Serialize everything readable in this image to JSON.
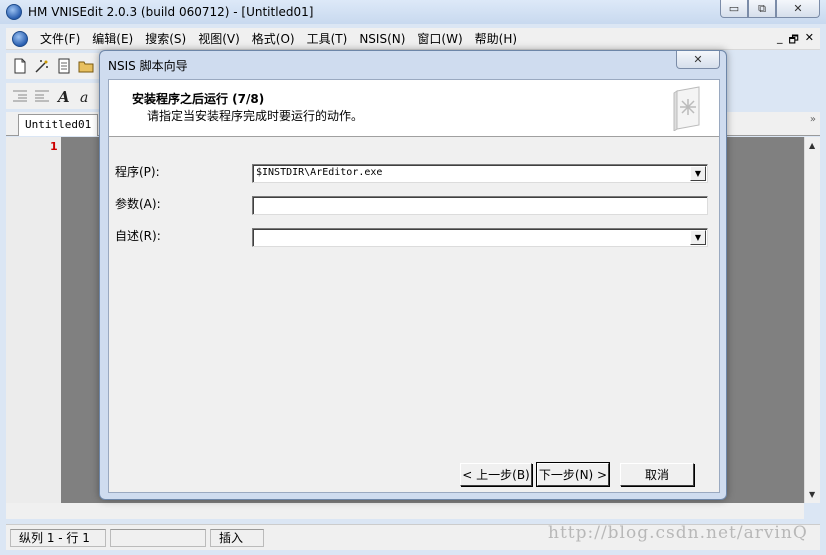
{
  "window": {
    "title": "HM VNISEdit 2.0.3 (build 060712) - [Untitled01]",
    "min_glyph": "▭",
    "restore_glyph": "⧉",
    "close_glyph": "✕"
  },
  "menu": {
    "items": [
      "文件(F)",
      "编辑(E)",
      "搜索(S)",
      "视图(V)",
      "格式(O)",
      "工具(T)",
      "NSIS(N)",
      "窗口(W)",
      "帮助(H)"
    ],
    "mdi_min": "_",
    "mdi_restore": "🗗",
    "mdi_close": "✕"
  },
  "editor": {
    "tab_label": "Untitled01",
    "line_number": "1",
    "tab_scroll": "»"
  },
  "statusbar": {
    "position": "纵列 1 - 行 1",
    "mode": "插入"
  },
  "watermark": "http://blog.csdn.net/arvinQ",
  "dialog": {
    "title": "NSIS 脚本向导",
    "close_glyph": "✕",
    "header_title": "安装程序之后运行 (7/8)",
    "header_subtitle": "请指定当安装程序完成时要运行的动作。",
    "fields": {
      "program_label": "程序(P):",
      "program_value": "$INSTDIR\\ArEditor.exe",
      "params_label": "参数(A):",
      "params_value": "",
      "readme_label": "自述(R):",
      "readme_value": ""
    },
    "buttons": {
      "back": "< 上一步(B)",
      "next": "下一步(N) >",
      "cancel": "取消"
    }
  }
}
